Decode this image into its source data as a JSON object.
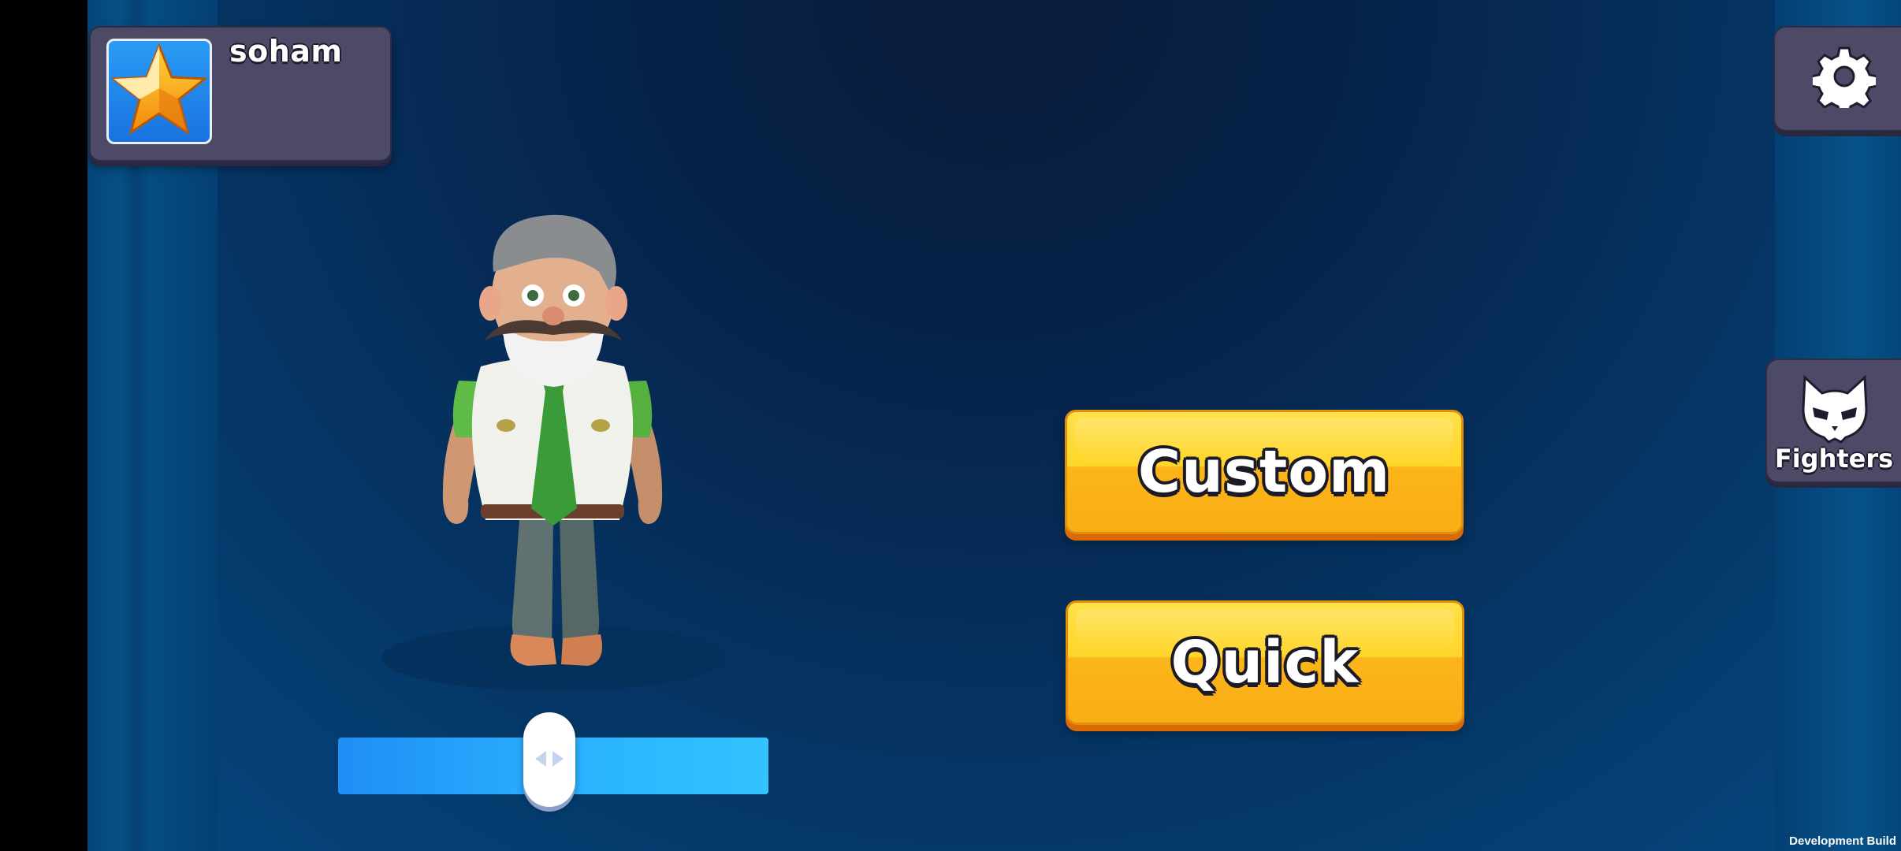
{
  "player": {
    "username": "soham",
    "avatar_icon": "star-icon"
  },
  "settings": {
    "icon": "gear-icon"
  },
  "fighters": {
    "label": "Fighters",
    "icon": "cat-mask-icon"
  },
  "buttons": {
    "custom_label": "Custom",
    "quick_label": "Quick"
  },
  "rotate_slider": {
    "value": 0.49,
    "handle_icon": "left-right-arrows-icon"
  },
  "footer": {
    "build_label": "Development Build"
  },
  "colors": {
    "background": "#053b6d",
    "panel": "#4c4a66",
    "button_yellow": "#ffd529",
    "button_shadow": "#d96a06",
    "slider_blue": "#2ab0ff"
  }
}
